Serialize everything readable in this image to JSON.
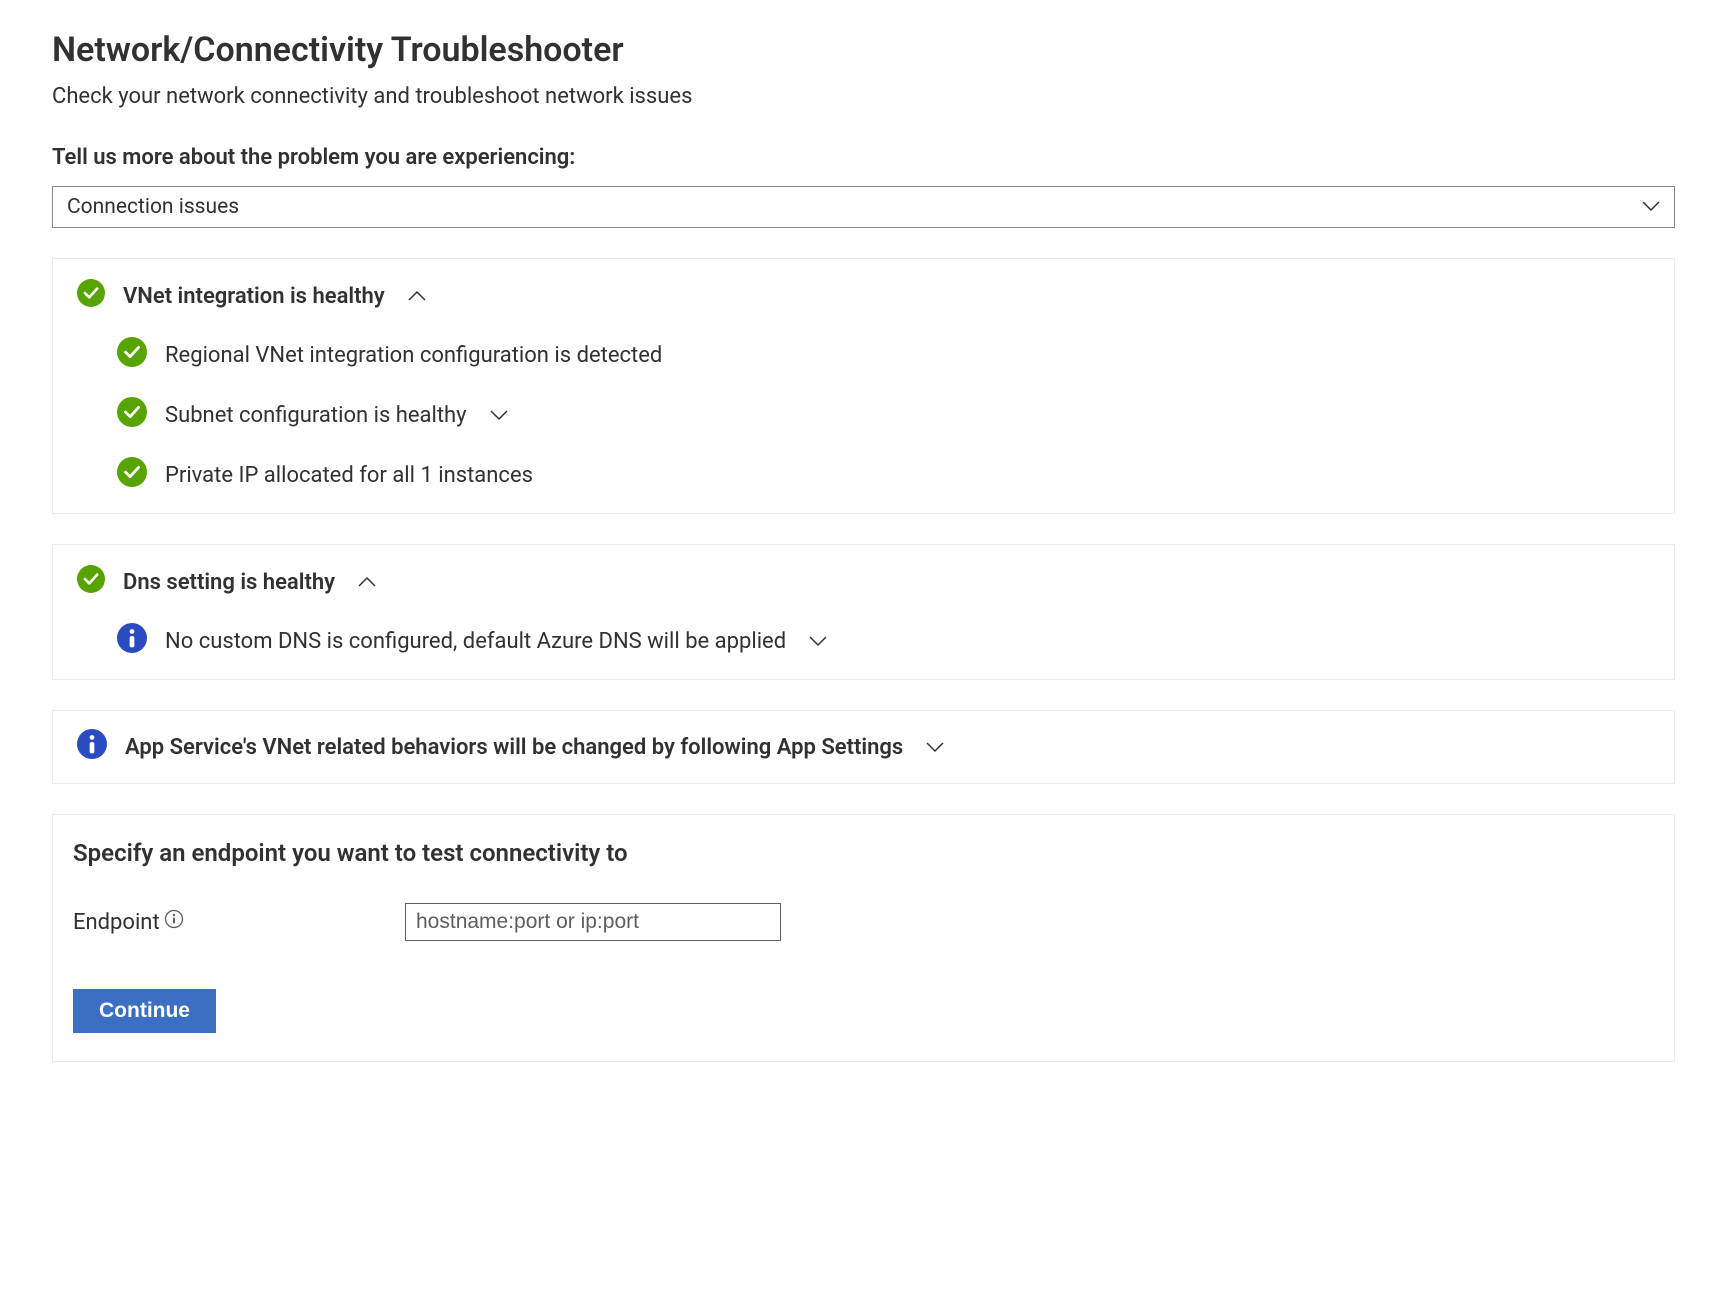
{
  "header": {
    "title": "Network/Connectivity Troubleshooter",
    "subtitle": "Check your network connectivity and troubleshoot network issues"
  },
  "prompt": {
    "label": "Tell us more about the problem you are experiencing:",
    "selected": "Connection issues"
  },
  "panels": {
    "vnet": {
      "title": "VNet integration is healthy",
      "items": [
        {
          "text": "Regional VNet integration configuration is detected",
          "expandable": false
        },
        {
          "text": "Subnet configuration is healthy",
          "expandable": true
        },
        {
          "text": "Private IP allocated for all 1 instances",
          "expandable": false
        }
      ]
    },
    "dns": {
      "title": "Dns setting is healthy",
      "info": "No custom DNS is configured, default Azure DNS will be applied"
    },
    "appservice": {
      "text": "App Service's VNet related behaviors will be changed by following App Settings"
    }
  },
  "endpoint": {
    "title": "Specify an endpoint you want to test connectivity to",
    "label": "Endpoint ",
    "placeholder": "hostname:port or ip:port",
    "button": "Continue"
  }
}
